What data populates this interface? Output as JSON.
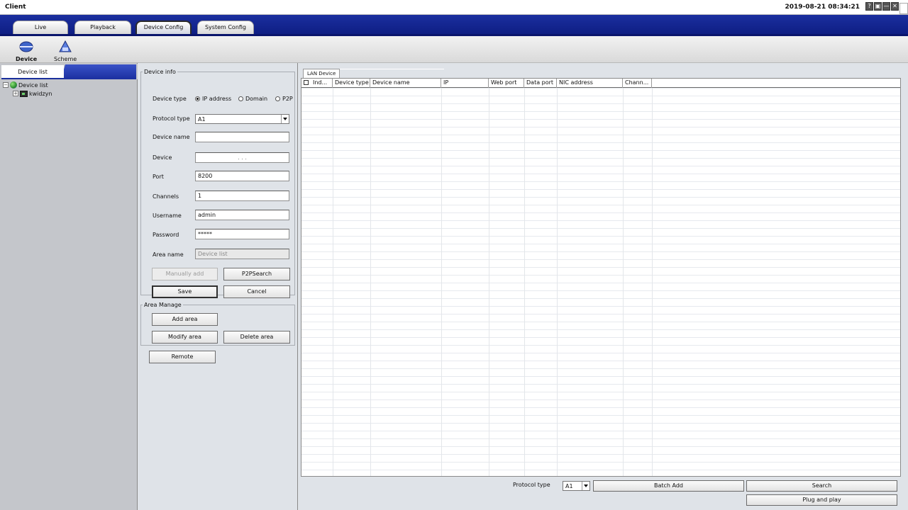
{
  "window": {
    "title": "Client",
    "clock": "2019-08-21 08:34:21",
    "buttons": [
      "?",
      "▣",
      "—",
      "✕"
    ]
  },
  "main_tabs": [
    {
      "label": "Live"
    },
    {
      "label": "Playback"
    },
    {
      "label": "Device Config"
    },
    {
      "label": "System Config"
    }
  ],
  "toolbar": {
    "device_label": "Device",
    "scheme_label": "Scheme"
  },
  "left_panel": {
    "tab_label": "Device list",
    "tree": {
      "root_label": "Device list",
      "child_label": "kwidzyn"
    }
  },
  "device_info": {
    "legend": "Device info",
    "device_type": {
      "label": "Device type",
      "options": [
        "IP address",
        "Domain",
        "P2P"
      ],
      "selected": "IP address"
    },
    "protocol_type": {
      "label": "Protocol type",
      "value": "A1"
    },
    "device_name": {
      "label": "Device name",
      "value": ""
    },
    "device": {
      "label": "Device",
      "value": ".   .   ."
    },
    "port": {
      "label": "Port",
      "value": "8200"
    },
    "channels": {
      "label": "Channels",
      "value": "1"
    },
    "username": {
      "label": "Username",
      "value": "admin"
    },
    "password": {
      "label": "Password",
      "value": "*****"
    },
    "area_name": {
      "label": "Area name",
      "value": "Device list"
    },
    "buttons": {
      "manually_add": "Manually add",
      "p2psearch": "P2PSearch",
      "save": "Save",
      "cancel": "Cancel"
    }
  },
  "area_manage": {
    "legend": "Area Manage",
    "add_area": "Add area",
    "modify_area": "Modify area",
    "delete_area": "Delete area"
  },
  "remote_button": "Remote",
  "lan_device": {
    "tab_label": "LAN Device",
    "columns": [
      "Ind...",
      "Device type",
      "Device name",
      "IP",
      "Web port",
      "Data port",
      "NIC address",
      "Chann..."
    ],
    "rows": [],
    "protocol_label": "Protocol type",
    "protocol_value": "A1",
    "batch_add": "Batch Add",
    "search": "Search",
    "plug_and_play": "Plug and play"
  }
}
